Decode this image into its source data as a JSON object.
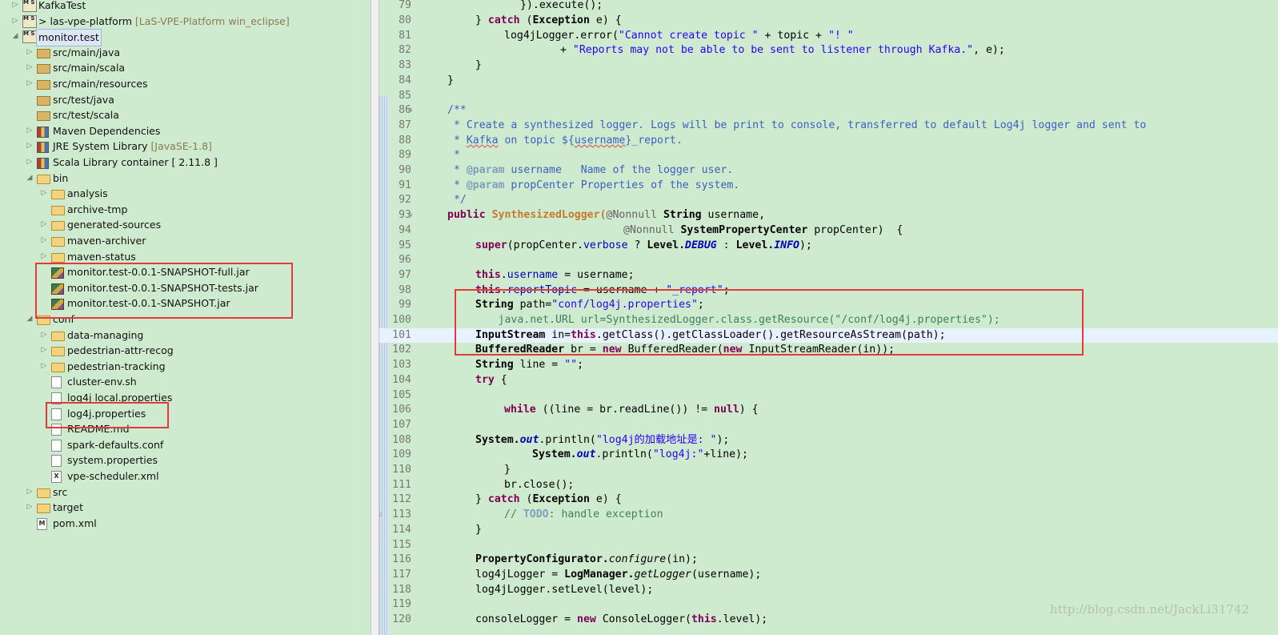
{
  "explorer": {
    "items": [
      {
        "label": "KafkaTest",
        "suffix": "",
        "arrow": "collapsed",
        "icon": "project-icon"
      },
      {
        "label": "> las-vpe-platform",
        "suffix": "[LaS-VPE-Platform win_eclipse]",
        "arrow": "collapsed",
        "icon": "project-icon"
      },
      {
        "label": "monitor.test",
        "suffix": "",
        "arrow": "expanded",
        "icon": "project-icon"
      },
      {
        "label": "src/main/java",
        "suffix": "",
        "arrow": "collapsed",
        "icon": "source-folder-icon"
      },
      {
        "label": "src/main/scala",
        "suffix": "",
        "arrow": "collapsed",
        "icon": "source-folder-icon"
      },
      {
        "label": "src/main/resources",
        "suffix": "",
        "arrow": "collapsed",
        "icon": "source-folder-icon"
      },
      {
        "label": "src/test/java",
        "suffix": "",
        "arrow": "none",
        "icon": "source-folder-icon"
      },
      {
        "label": "src/test/scala",
        "suffix": "",
        "arrow": "none",
        "icon": "source-folder-icon"
      },
      {
        "label": "Maven Dependencies",
        "suffix": "",
        "arrow": "collapsed",
        "icon": "library-icon"
      },
      {
        "label": "JRE System Library",
        "suffix": "[JavaSE-1.8]",
        "arrow": "collapsed",
        "icon": "library-icon"
      },
      {
        "label": "Scala Library container [ 2.11.8 ]",
        "suffix": "",
        "arrow": "collapsed",
        "icon": "library-icon"
      },
      {
        "label": "bin",
        "suffix": "",
        "arrow": "expanded",
        "icon": "folder-icon"
      },
      {
        "label": "analysis",
        "suffix": "",
        "arrow": "collapsed",
        "icon": "folder-icon"
      },
      {
        "label": "archive-tmp",
        "suffix": "",
        "arrow": "none",
        "icon": "folder-icon"
      },
      {
        "label": "generated-sources",
        "suffix": "",
        "arrow": "collapsed",
        "icon": "folder-icon"
      },
      {
        "label": "maven-archiver",
        "suffix": "",
        "arrow": "collapsed",
        "icon": "folder-icon"
      },
      {
        "label": "maven-status",
        "suffix": "",
        "arrow": "collapsed",
        "icon": "folder-icon"
      },
      {
        "label": "monitor.test-0.0.1-SNAPSHOT-full.jar",
        "suffix": "",
        "arrow": "none",
        "icon": "jar-icon"
      },
      {
        "label": "monitor.test-0.0.1-SNAPSHOT-tests.jar",
        "suffix": "",
        "arrow": "none",
        "icon": "jar-icon"
      },
      {
        "label": "monitor.test-0.0.1-SNAPSHOT.jar",
        "suffix": "",
        "arrow": "none",
        "icon": "jar-icon"
      },
      {
        "label": "conf",
        "suffix": "",
        "arrow": "expanded",
        "icon": "folder-icon"
      },
      {
        "label": "data-managing",
        "suffix": "",
        "arrow": "collapsed",
        "icon": "folder-icon"
      },
      {
        "label": "pedestrian-attr-recog",
        "suffix": "",
        "arrow": "collapsed",
        "icon": "folder-icon"
      },
      {
        "label": "pedestrian-tracking",
        "suffix": "",
        "arrow": "collapsed",
        "icon": "folder-icon"
      },
      {
        "label": "cluster-env.sh",
        "suffix": "",
        "arrow": "none",
        "icon": "file-icon"
      },
      {
        "label": "log4j local.properties",
        "suffix": "",
        "arrow": "none",
        "icon": "file-icon"
      },
      {
        "label": "log4j.properties",
        "suffix": "",
        "arrow": "none",
        "icon": "file-icon"
      },
      {
        "label": "README.md",
        "suffix": "",
        "arrow": "none",
        "icon": "file-icon"
      },
      {
        "label": "spark-defaults.conf",
        "suffix": "",
        "arrow": "none",
        "icon": "file-icon"
      },
      {
        "label": "system.properties",
        "suffix": "",
        "arrow": "none",
        "icon": "file-icon"
      },
      {
        "label": "vpe-scheduler.xml",
        "suffix": "",
        "arrow": "none",
        "icon": "xml-file-icon"
      },
      {
        "label": "src",
        "suffix": "",
        "arrow": "collapsed",
        "icon": "folder-icon"
      },
      {
        "label": "target",
        "suffix": "",
        "arrow": "collapsed",
        "icon": "folder-icon"
      },
      {
        "label": "pom.xml",
        "suffix": "",
        "arrow": "none",
        "icon": "maven-file-icon"
      }
    ]
  },
  "editor": {
    "line_numbers": [
      "79",
      "80",
      "81",
      "82",
      "83",
      "84",
      "85",
      "86",
      "87",
      "88",
      "89",
      "90",
      "91",
      "92",
      "93",
      "94",
      "95",
      "96",
      "97",
      "98",
      "99",
      "100",
      "101",
      "102",
      "103",
      "104",
      "105",
      "106",
      "107",
      "108",
      "109",
      "110",
      "111",
      "112",
      "113",
      "114",
      "115",
      "116",
      "117",
      "118",
      "119",
      "120"
    ],
    "code": {
      "l79": "}).execute();",
      "l80a": "} ",
      "l80b": "catch",
      "l80c": " (",
      "l80d": "Exception",
      "l80e": " e) {",
      "l81a": "log4jLogger.error(",
      "l81b": "\"Cannot create topic \"",
      "l81c": " + topic + ",
      "l81d": "\"! \"",
      "l82a": "+ ",
      "l82b": "\"Reports may not be able to be sent to listener through Kafka.\"",
      "l82c": ", e);",
      "l83": "}",
      "l84": "}",
      "l85": "",
      "l86": "/**",
      "l87": " * Create a synthesized logger. Logs will be print to console, transferred to default Log4j logger and sent to",
      "l88a": " * ",
      "l88b": "Kafka",
      "l88c": " on topic ${",
      "l88d": "username",
      "l88e": "}_report.",
      "l89": " *",
      "l90a": " * ",
      "l90b": "@param",
      "l90c": " username   Name of the logger user.",
      "l91a": " * ",
      "l91b": "@param",
      "l91c": " propCenter Properties of the system.",
      "l92": " */",
      "l93a": "public",
      "l93b": " SynthesizedLogger(",
      "l93c": "@Nonnull",
      "l93d": " String",
      "l93e": " username,",
      "l94a": "@Nonnull",
      "l94b": " SystemPropertyCenter",
      "l94c": " propCenter)  {",
      "l95a": "super",
      "l95b": "(propCenter.",
      "l95c": "verbose",
      "l95d": " ? ",
      "l95e": "Level.",
      "l95f": "DEBUG",
      "l95g": " : ",
      "l95h": "Level.",
      "l95i": "INFO",
      "l95j": ");",
      "l96": "",
      "l97a": "this",
      "l97b": ".",
      "l97c": "username",
      "l97d": " = username;",
      "l98a": "this",
      "l98b": ".",
      "l98c": "reportTopic",
      "l98d": " = username + ",
      "l98e": "\"_report\"",
      "l98f": ";",
      "l99a": "String",
      "l99b": " path=",
      "l99c": "\"conf/log4j.properties\"",
      "l99d": ";",
      "l100a": "//",
      "l100b": "        java.net.URL url=SynthesizedLogger.class.getResource(\"/conf/log4j.properties\");",
      "l101a": "InputStream",
      "l101b": " in=",
      "l101c": "this",
      "l101d": ".getClass().getClassLoader().getResourceAsStream(path);",
      "l102a": "BufferedReader",
      "l102b": " br = ",
      "l102c": "new",
      "l102d": " BufferedReader(",
      "l102e": "new",
      "l102f": " InputStreamReader(in));",
      "l103a": "String",
      "l103b": " line = ",
      "l103c": "\"\"",
      "l103d": ";",
      "l104a": "try",
      "l104b": " {",
      "l105": "",
      "l106a": "while",
      "l106b": " ((line = br.readLine()) != ",
      "l106c": "null",
      "l106d": ") {",
      "l107": "",
      "l108a": "System.",
      "l108b": "out",
      "l108c": ".println(",
      "l108d": "\"log4j的加载地址是: \"",
      "l108e": ");",
      "l109a": "System.",
      "l109b": "out",
      "l109c": ".println(",
      "l109d": "\"log4j:\"",
      "l109e": "+line);",
      "l110": "}",
      "l111": "br.close();",
      "l112a": "} ",
      "l112b": "catch",
      "l112c": " (",
      "l112d": "Exception",
      "l112e": " e) {",
      "l113a": "// ",
      "l113b": "TODO",
      "l113c": ": handle exception",
      "l114": "}",
      "l115": "",
      "l116a": "PropertyConfigurator.",
      "l116b": "configure",
      "l116c": "(in);",
      "l117a": "log4jLogger = ",
      "l117b": "LogManager.",
      "l117c": "getLogger",
      "l117d": "(username);",
      "l118": "log4jLogger.setLevel(level);",
      "l119": "",
      "l120a": "consoleLogger = ",
      "l120b": "new",
      "l120c": " ConsoleLogger(",
      "l120d": "this",
      "l120e": ".level);"
    }
  },
  "watermark": "http://blog.csdn.net/JackLi31742",
  "colors": {
    "highlight_box": "#e33b3b",
    "background": "#cfebcf"
  }
}
